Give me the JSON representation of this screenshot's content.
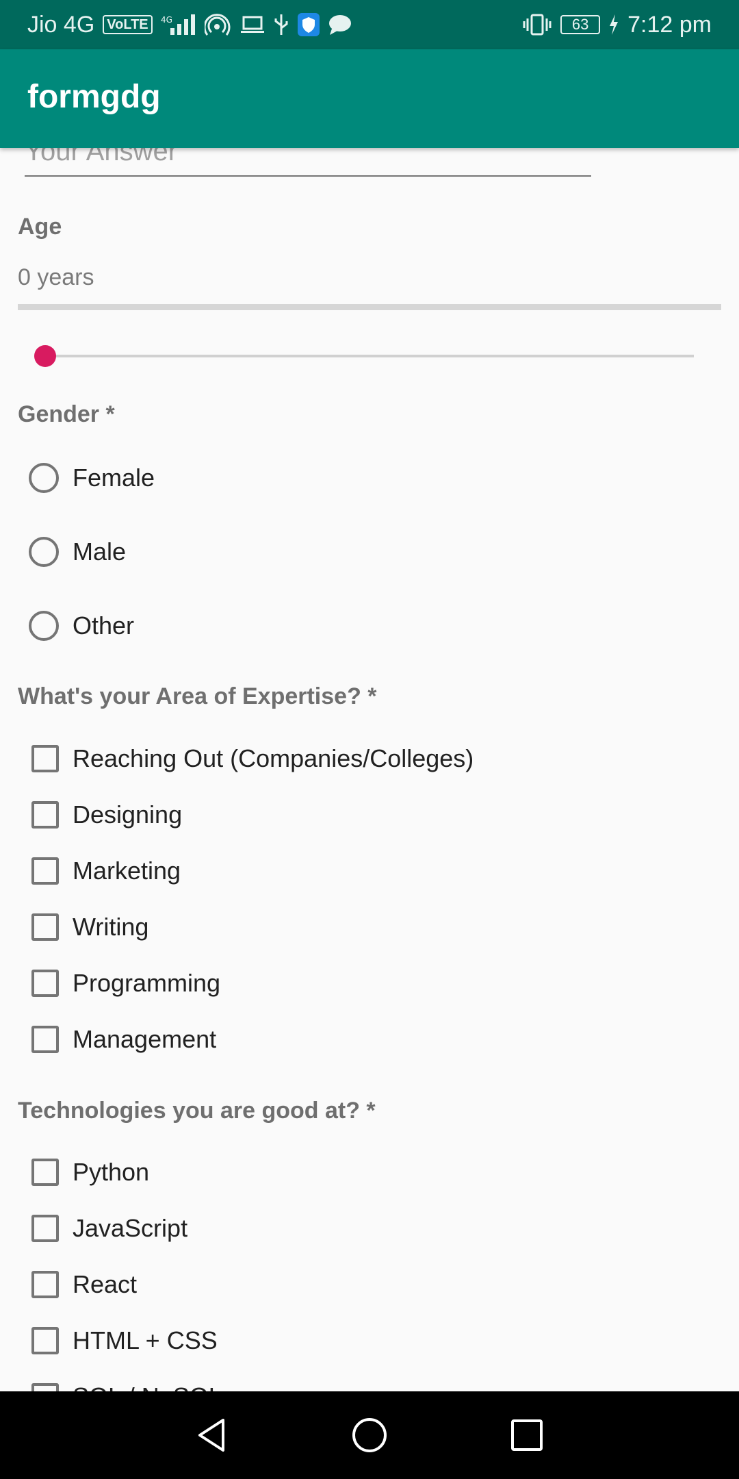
{
  "status_bar": {
    "carrier": "Jio 4G",
    "volte": "VoLTE",
    "battery": "63",
    "time": "7:12 pm"
  },
  "app_bar": {
    "title": "formgdg"
  },
  "answer_field": {
    "placeholder": "Your Answer"
  },
  "age": {
    "label": "Age",
    "value": "0 years",
    "slider_value": 0
  },
  "gender": {
    "label": "Gender *",
    "options": [
      "Female",
      "Male",
      "Other"
    ]
  },
  "expertise": {
    "label": "What's your Area of Expertise? *",
    "options": [
      "Reaching Out (Companies/Colleges)",
      "Designing",
      "Marketing",
      "Writing",
      "Programming",
      "Management"
    ]
  },
  "technologies": {
    "label": "Technologies you are good at? *",
    "options": [
      "Python",
      "JavaScript",
      "React",
      "HTML + CSS",
      "SQL / NoSQL"
    ]
  },
  "colors": {
    "status_bar": "#00695c",
    "app_bar": "#00897b",
    "accent": "#d81b60"
  }
}
